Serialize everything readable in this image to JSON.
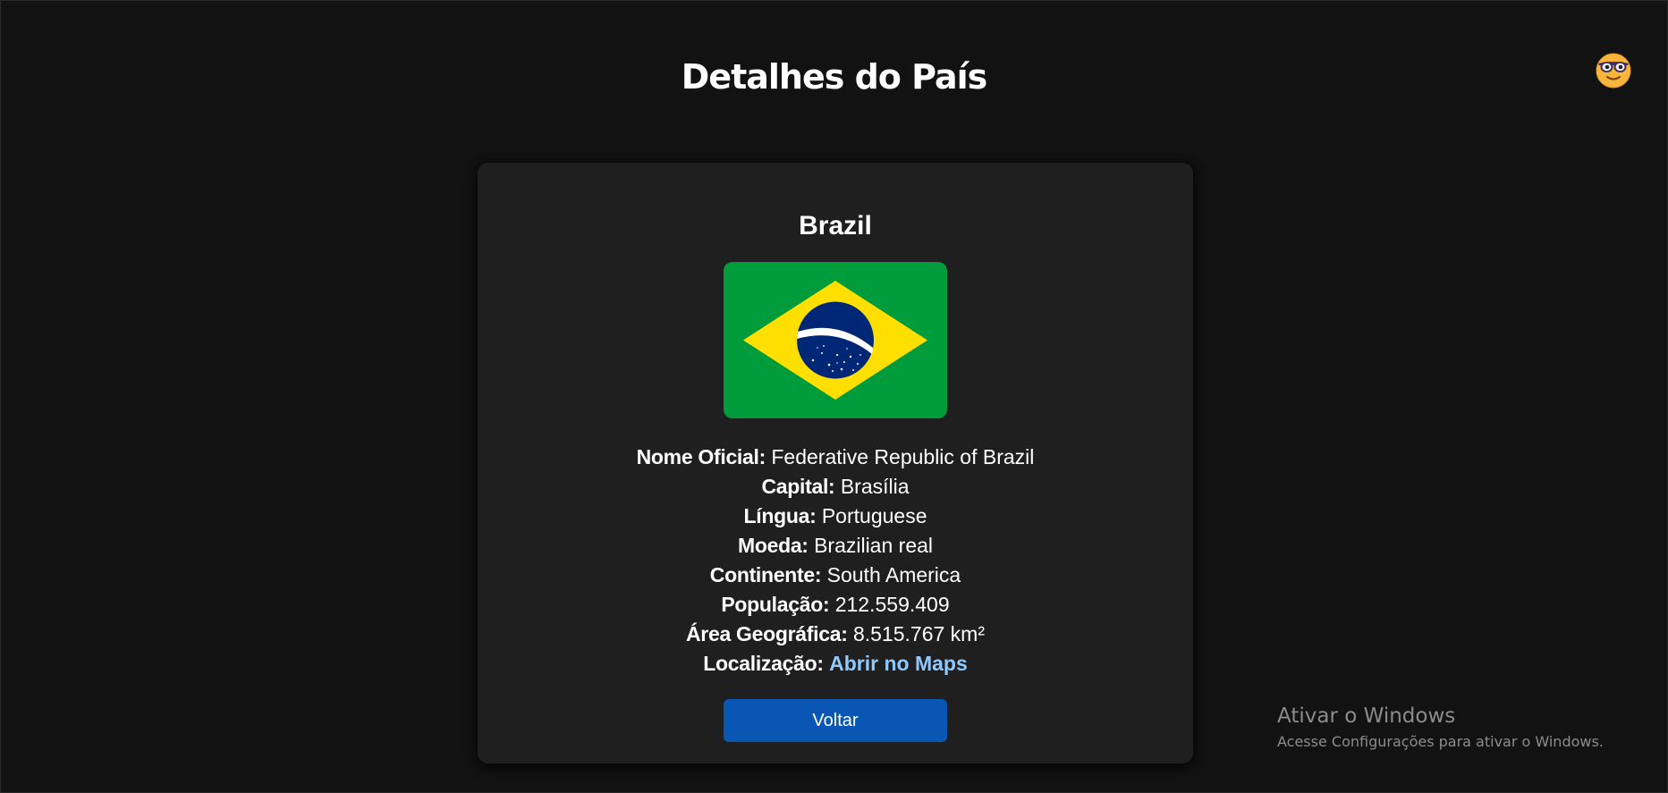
{
  "page": {
    "title": "Detalhes do País"
  },
  "theme_toggle": {
    "icon": "sunglasses-face-icon"
  },
  "country": {
    "name": "Brazil",
    "flag_icon": "brazil-flag",
    "details": [
      {
        "label": "Nome Oficial:",
        "value": "Federative Republic of Brazil"
      },
      {
        "label": "Capital:",
        "value": "Brasília"
      },
      {
        "label": "Língua:",
        "value": "Portuguese"
      },
      {
        "label": "Moeda:",
        "value": "Brazilian real"
      },
      {
        "label": "Continente:",
        "value": "South America"
      },
      {
        "label": "População:",
        "value": "212.559.409"
      },
      {
        "label": "Área Geográfica:",
        "value": "8.515.767 km²"
      }
    ],
    "location": {
      "label": "Localização:",
      "link_text": "Abrir no Maps"
    }
  },
  "actions": {
    "back_label": "Voltar"
  },
  "colors": {
    "background": "#121212",
    "card": "#1f1f1f",
    "link": "#8ec9ff",
    "button": "#0a56b4"
  },
  "windows_watermark": {
    "title": "Ativar o Windows",
    "subtitle": "Acesse Configurações para ativar o Windows."
  }
}
